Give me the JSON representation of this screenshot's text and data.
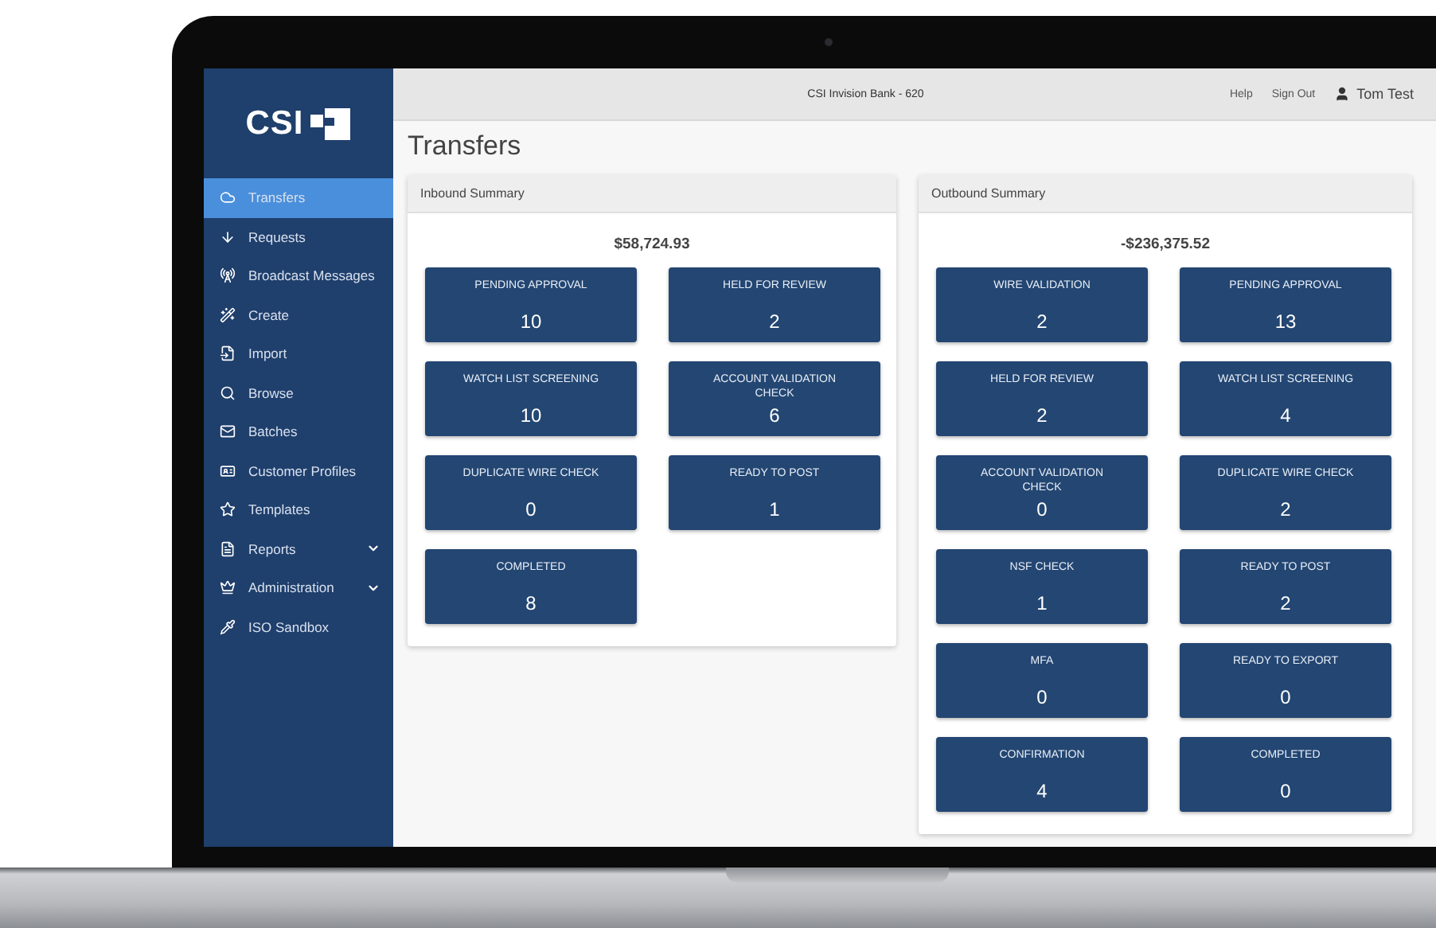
{
  "header": {
    "bank": "CSI Invision Bank - 620",
    "links": [
      "Help",
      "Sign Out"
    ],
    "user": "Tom Test"
  },
  "sidebar": {
    "logo": "CSI",
    "items": [
      {
        "label": "Transfers",
        "selected": true,
        "submenu": false
      },
      {
        "label": "Requests",
        "selected": false,
        "submenu": false
      },
      {
        "label": "Broadcast Messages",
        "selected": false,
        "submenu": false
      },
      {
        "label": "Create",
        "selected": false,
        "submenu": false
      },
      {
        "label": "Import",
        "selected": false,
        "submenu": false
      },
      {
        "label": "Browse",
        "selected": false,
        "submenu": false
      },
      {
        "label": "Batches",
        "selected": false,
        "submenu": false
      },
      {
        "label": "Customer Profiles",
        "selected": false,
        "submenu": false
      },
      {
        "label": "Templates",
        "selected": false,
        "submenu": false
      },
      {
        "label": "Reports",
        "selected": false,
        "submenu": true
      },
      {
        "label": "Administration",
        "selected": false,
        "submenu": true
      },
      {
        "label": "ISO Sandbox",
        "selected": false,
        "submenu": false
      }
    ]
  },
  "page_title": "Transfers",
  "panels": [
    {
      "title": "Inbound Summary",
      "total": "$58,724.93",
      "tiles": [
        {
          "label": "PENDING APPROVAL",
          "count": "10"
        },
        {
          "label": "HELD FOR REVIEW",
          "count": "2"
        },
        {
          "label": "WATCH LIST SCREENING",
          "count": "10"
        },
        {
          "label": "ACCOUNT VALIDATION CHECK",
          "count": "6"
        },
        {
          "label": "DUPLICATE WIRE CHECK",
          "count": "0"
        },
        {
          "label": "READY TO POST",
          "count": "1"
        },
        {
          "label": "COMPLETED",
          "count": "8"
        }
      ]
    },
    {
      "title": "Outbound Summary",
      "total": "-$236,375.52",
      "tiles": [
        {
          "label": "WIRE VALIDATION",
          "count": "2"
        },
        {
          "label": "PENDING APPROVAL",
          "count": "13"
        },
        {
          "label": "HELD FOR REVIEW",
          "count": "2"
        },
        {
          "label": "WATCH LIST SCREENING",
          "count": "4"
        },
        {
          "label": "ACCOUNT VALIDATION CHECK",
          "count": "0"
        },
        {
          "label": "DUPLICATE WIRE CHECK",
          "count": "2"
        },
        {
          "label": "NSF CHECK",
          "count": "1"
        },
        {
          "label": "READY TO POST",
          "count": "2"
        },
        {
          "label": "MFA",
          "count": "0"
        },
        {
          "label": "READY TO EXPORT",
          "count": "0"
        },
        {
          "label": "CONFIRMATION",
          "count": "4"
        },
        {
          "label": "COMPLETED",
          "count": "0"
        }
      ]
    }
  ]
}
